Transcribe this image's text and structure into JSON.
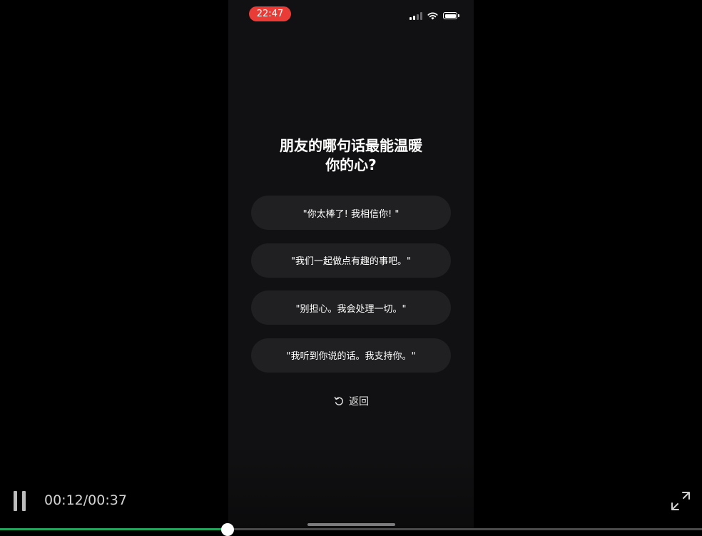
{
  "status_bar": {
    "time": "22:47",
    "time_pill_color": "#ea3c37",
    "icons": [
      "signal-icon",
      "wifi-icon",
      "battery-icon"
    ]
  },
  "question": {
    "line1": "朋友的哪句话最能温暖",
    "line2": "你的心?"
  },
  "options": [
    "\"你太棒了! 我相信你! \"",
    "\"我们一起做点有趣的事吧。\"",
    "\"别担心。我会处理一切。\"",
    "\"我听到你说的话。我支持你。\""
  ],
  "back": {
    "label": "返回",
    "icon": "undo-icon"
  },
  "player": {
    "state": "playing",
    "pause_icon": "pause-icon",
    "time": "00:12/00:37",
    "current_seconds": 12,
    "total_seconds": 37,
    "fullscreen_icon": "fullscreen-icon",
    "played_color": "#23a35a"
  }
}
